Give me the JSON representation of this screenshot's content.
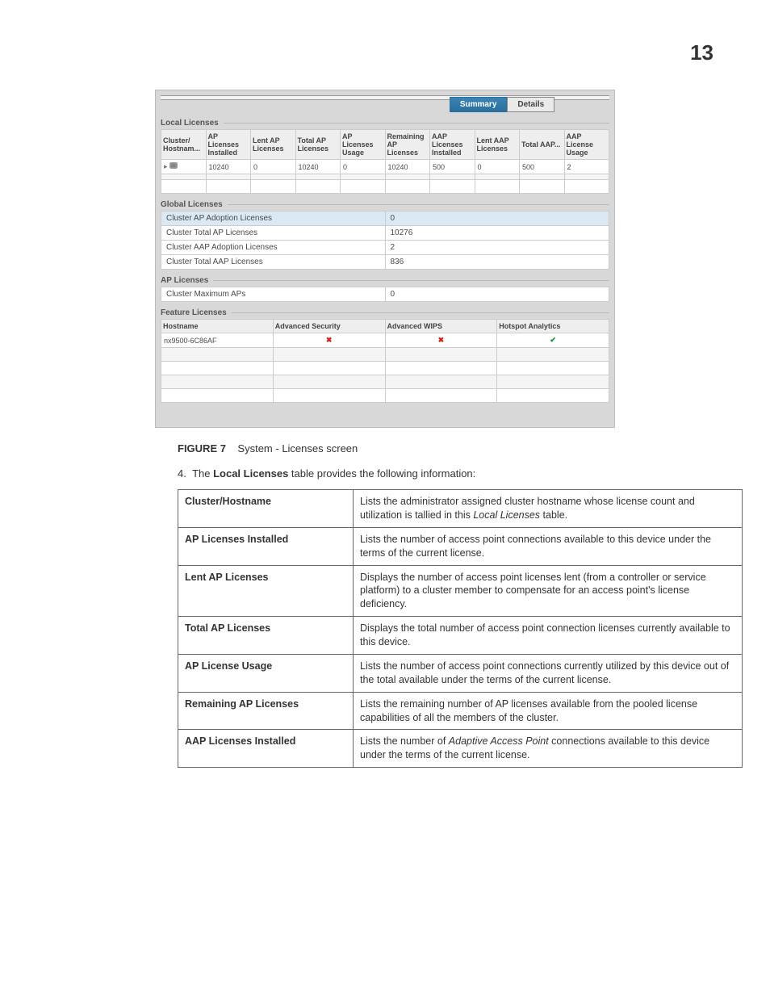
{
  "page_number": "13",
  "ss": {
    "tabs": {
      "summary": "Summary",
      "details": "Details"
    },
    "local_licenses_label": "Local Licenses",
    "local_headers": {
      "cluster": "Cluster/ Hostnam...",
      "ap_installed": "AP Licenses Installed",
      "lent_ap": "Lent AP Licenses",
      "total_ap": "Total AP Licenses",
      "ap_usage": "AP Licenses Usage",
      "remaining_ap": "Remaining AP Licenses",
      "aap_installed": "AAP Licenses Installed",
      "lent_aap": "Lent AAP Licenses",
      "total_aap": "Total AAP...",
      "aap_usage": "AAP License Usage"
    },
    "local_row": {
      "cluster": "",
      "ap_installed": "10240",
      "lent_ap": "0",
      "total_ap": "10240",
      "ap_usage": "0",
      "remaining_ap": "10240",
      "aap_installed": "500",
      "lent_aap": "0",
      "total_aap": "500",
      "aap_usage": "2"
    },
    "global_licenses_label": "Global Licenses",
    "global_rows": {
      "r0k": "Cluster AP Adoption Licenses",
      "r0v": "0",
      "r1k": "Cluster Total AP Licenses",
      "r1v": "10276",
      "r2k": "Cluster AAP Adoption Licenses",
      "r2v": "2",
      "r3k": "Cluster Total AAP Licenses",
      "r3v": "836"
    },
    "ap_licenses_label": "AP Licenses",
    "ap_row": {
      "k": "Cluster Maximum APs",
      "v": "0"
    },
    "feature_licenses_label": "Feature Licenses",
    "feature_headers": {
      "host": "Hostname",
      "adv_sec": "Advanced Security",
      "adv_wips": "Advanced WIPS",
      "hotspot": "Hotspot Analytics"
    },
    "feature_row": {
      "host": "nx9500-6C86AF",
      "adv_sec": "✖",
      "adv_wips": "✖",
      "hotspot": "✔"
    }
  },
  "figure": {
    "label": "FIGURE 7",
    "caption": "System - Licenses screen"
  },
  "step": {
    "num": "4.",
    "pre": "The ",
    "bold": "Local Licenses",
    "post": " table provides the following information:"
  },
  "doc_rows": [
    {
      "term": "Cluster/Hostname",
      "desc_pre": "Lists the administrator assigned cluster hostname whose license count and utilization is tallied in this ",
      "italic": "Local Licenses",
      "desc_post": " table."
    },
    {
      "term": "AP Licenses Installed",
      "desc": "Lists the number of access point connections available to this device under the terms of the current license."
    },
    {
      "term": "Lent AP Licenses",
      "desc": "Displays the number of access point licenses lent (from a controller or service platform) to a cluster member to compensate for an access point's license deficiency."
    },
    {
      "term": "Total AP Licenses",
      "desc": "Displays the total number of access point connection licenses currently available to this device."
    },
    {
      "term": "AP License Usage",
      "desc": "Lists the number of access point connections currently utilized by this device out of the total available under the terms of the current license."
    },
    {
      "term": "Remaining AP Licenses",
      "desc": "Lists the remaining number of AP licenses available from the pooled license capabilities of all the members of the cluster."
    },
    {
      "term": "AAP Licenses Installed",
      "desc_pre": "Lists the number of ",
      "italic": "Adaptive Access Point",
      "desc_post": " connections available to this device under the terms of the current license."
    }
  ]
}
